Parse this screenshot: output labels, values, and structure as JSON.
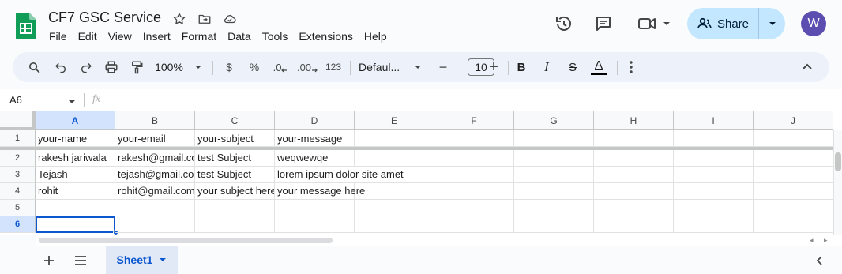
{
  "doc": {
    "title": "CF7 GSC Service"
  },
  "menu": [
    "File",
    "Edit",
    "View",
    "Insert",
    "Format",
    "Data",
    "Tools",
    "Extensions",
    "Help"
  ],
  "share": {
    "label": "Share"
  },
  "avatar": {
    "initial": "W",
    "color": "#5c4db1"
  },
  "toolbar": {
    "zoom": "100%",
    "currency": "$",
    "percent": "%",
    "dec_decrease": ".0",
    "dec_increase": ".00",
    "number_format": "123",
    "font": "Defaul...",
    "font_size": "10",
    "minus": "−",
    "plus": "+",
    "bold": "B",
    "italic": "I",
    "strike": "S",
    "text_color": "A"
  },
  "formula": {
    "name_box": "A6",
    "fx": "fx"
  },
  "grid": {
    "columns": [
      "A",
      "B",
      "C",
      "D",
      "E",
      "F",
      "G",
      "H",
      "I",
      "J"
    ],
    "rows": [
      "1",
      "2",
      "3",
      "4",
      "5",
      "6"
    ],
    "cells": [
      [
        "your-name",
        "your-email",
        "your-subject",
        "your-message"
      ],
      [
        "rakesh jariwala",
        "rakesh@gmail.com",
        "test Subject",
        "weqwewqe"
      ],
      [
        "Tejash",
        "tejash@gmail.com",
        "test Subject",
        "lorem ipsum dolor site amet"
      ],
      [
        "rohit",
        "rohit@gmail.com",
        "your subject here",
        "your message here"
      ],
      [
        "",
        "",
        "",
        ""
      ],
      [
        "",
        "",
        "",
        ""
      ]
    ],
    "selected": "A6"
  },
  "sheet": {
    "tab_label": "Sheet1"
  },
  "colors": {
    "accent": "#0b57d0",
    "share_bg": "#c2e7ff",
    "sheets_green": "#0f9d58"
  }
}
